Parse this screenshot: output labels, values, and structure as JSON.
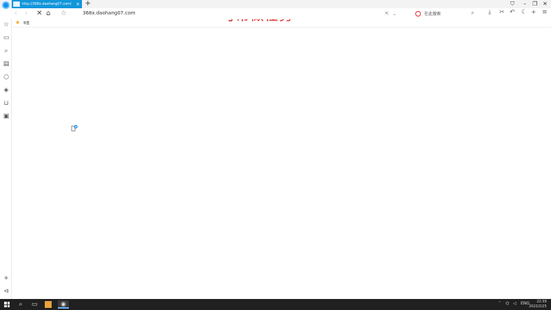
{
  "tab": {
    "title": "http://368x.daohang07.com/",
    "close_icon": "×"
  },
  "watermark": "可帮做任务",
  "toolbar": {
    "url": "368x.daohang07.com",
    "search_placeholder": "在此搜索"
  },
  "bookmarks": {
    "label": "书签"
  },
  "taskbar": {
    "lang": "ENG",
    "time": "22:39",
    "date": "2022/2/25"
  },
  "colors": {
    "tab_active": "#1296db",
    "watermark": "#e02020",
    "taskbar": "#202020"
  }
}
